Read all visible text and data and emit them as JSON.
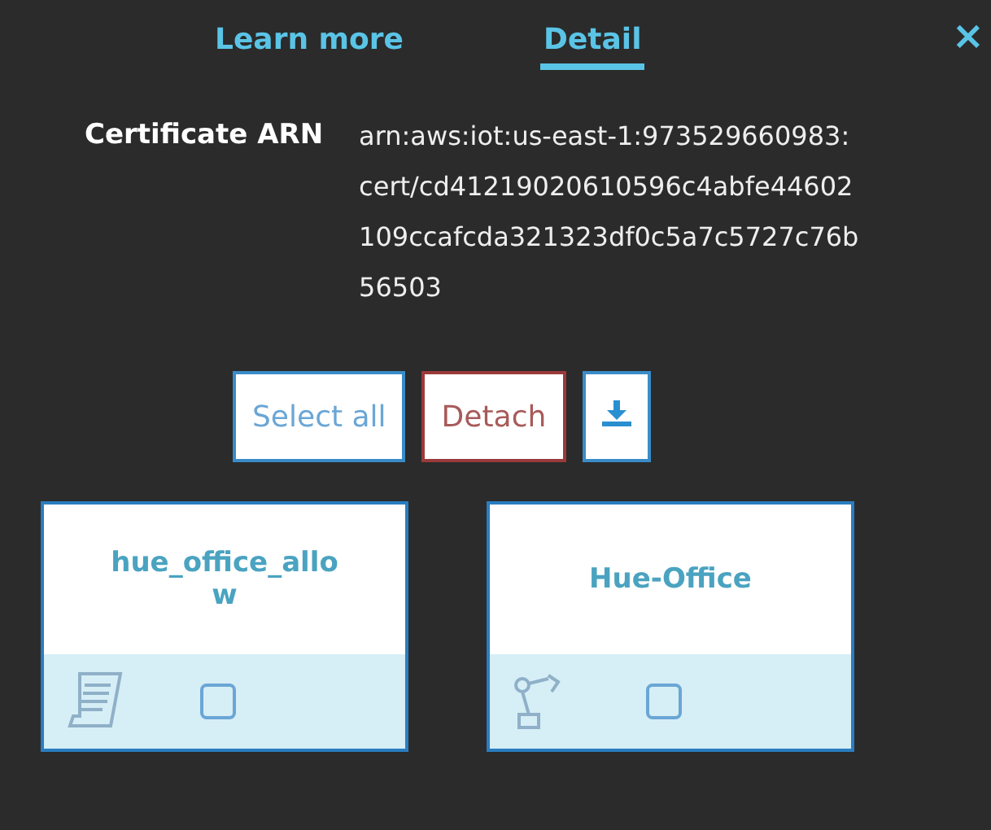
{
  "tabs": [
    {
      "label": "Learn more",
      "selected": false
    },
    {
      "label": "Detail",
      "selected": true
    }
  ],
  "close": "×",
  "certificate": {
    "label": "Certificate ARN",
    "value": "arn:aws:iot:us-east-1:973529660983:cert/cd41219020610596c4abfe44602109ccafcda321323df0c5a7c5727c76b56503"
  },
  "actions": [
    {
      "kind": "text",
      "label": "Select all"
    },
    {
      "kind": "danger",
      "label": "Detach"
    },
    {
      "kind": "download"
    }
  ],
  "cards": [
    {
      "kind": "policy",
      "title": "hue_office_allow",
      "checked": false
    },
    {
      "kind": "thing",
      "title": "Hue-Office",
      "checked": false
    }
  ]
}
